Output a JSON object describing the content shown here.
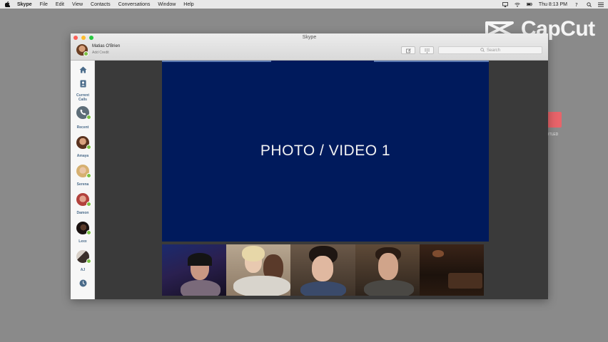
{
  "menubar": {
    "app": "Skype",
    "items": [
      "File",
      "Edit",
      "View",
      "Contacts",
      "Conversations",
      "Window",
      "Help"
    ],
    "clock": "Thu 8:13 PM"
  },
  "watermark": {
    "text": "CapCut"
  },
  "desktop": {
    "icon_label": "TITLED"
  },
  "window": {
    "title": "Skype",
    "user_name": "Matias O'Brien",
    "credit_link": "Add Credit",
    "search_placeholder": "Search"
  },
  "sidebar": {
    "current_calls_label": "Current Calls",
    "recent_label": "Recent",
    "contacts": [
      {
        "name": "Amaya",
        "color": "#b07a5a"
      },
      {
        "name": "Serena",
        "color": "#c9a27a"
      },
      {
        "name": "Damon",
        "color": "#b56a5a"
      },
      {
        "name": "Lexx",
        "color": "#3a2a22"
      },
      {
        "name": "AJ",
        "color": "#6a5a52"
      }
    ]
  },
  "call": {
    "main_label": "PHOTO / VIDEO 1",
    "participants": 5
  },
  "colors": {
    "video_bg": "#001a5c",
    "online": "#7bc043",
    "accent": "#4a6b8a"
  }
}
